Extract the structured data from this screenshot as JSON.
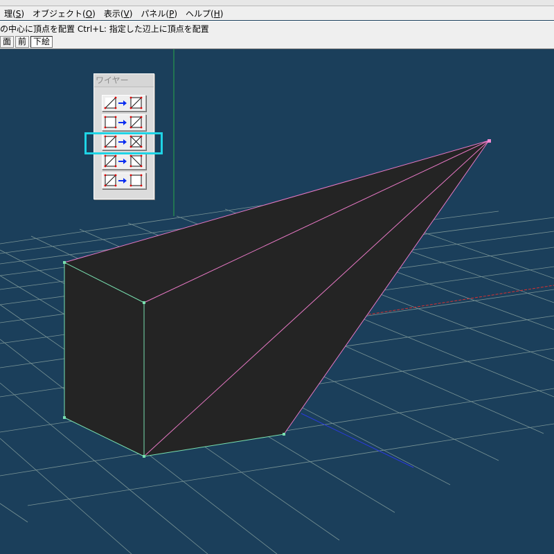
{
  "menu": {
    "items": [
      {
        "label": "理(",
        "key": "S",
        "close": ")"
      },
      {
        "label": "オブジェクト(",
        "key": "O",
        "close": ")"
      },
      {
        "label": "表示(",
        "key": "V",
        "close": ")"
      },
      {
        "label": "パネル(",
        "key": "P",
        "close": ")"
      },
      {
        "label": "ヘルプ(",
        "key": "H",
        "close": ")"
      }
    ]
  },
  "hint": {
    "text": "の中心に頂点を配置 Ctrl+L: 指定した辺上に頂点を配置"
  },
  "tabs": [
    {
      "label": "面",
      "active": false
    },
    {
      "label": "前",
      "active": false
    },
    {
      "label": "下絵",
      "active": true
    }
  ],
  "palette": {
    "title": "ワイヤー",
    "buttons": [
      {
        "name": "triangle-to-quad-diagonal",
        "icon": "triangle-to-square-icon"
      },
      {
        "name": "square-to-quad-diagonal",
        "icon": "square-to-diagonal-icon"
      },
      {
        "name": "diagonal-to-cross",
        "icon": "diagonal-to-cross-icon"
      },
      {
        "name": "flip-diagonal",
        "icon": "flip-diagonal-icon"
      },
      {
        "name": "remove-diagonal",
        "icon": "remove-diagonal-icon"
      }
    ]
  },
  "colors": {
    "background": "#1b3f5b",
    "grid": "#8aa3a0",
    "x_axis": "#d83030",
    "y_axis": "#2aa84a",
    "z_axis": "#2a3adf",
    "selected_edges": "#e979c6",
    "edges": "#79e0b0",
    "highlight": "#1fd4e6",
    "mesh_fill": "#242424"
  }
}
